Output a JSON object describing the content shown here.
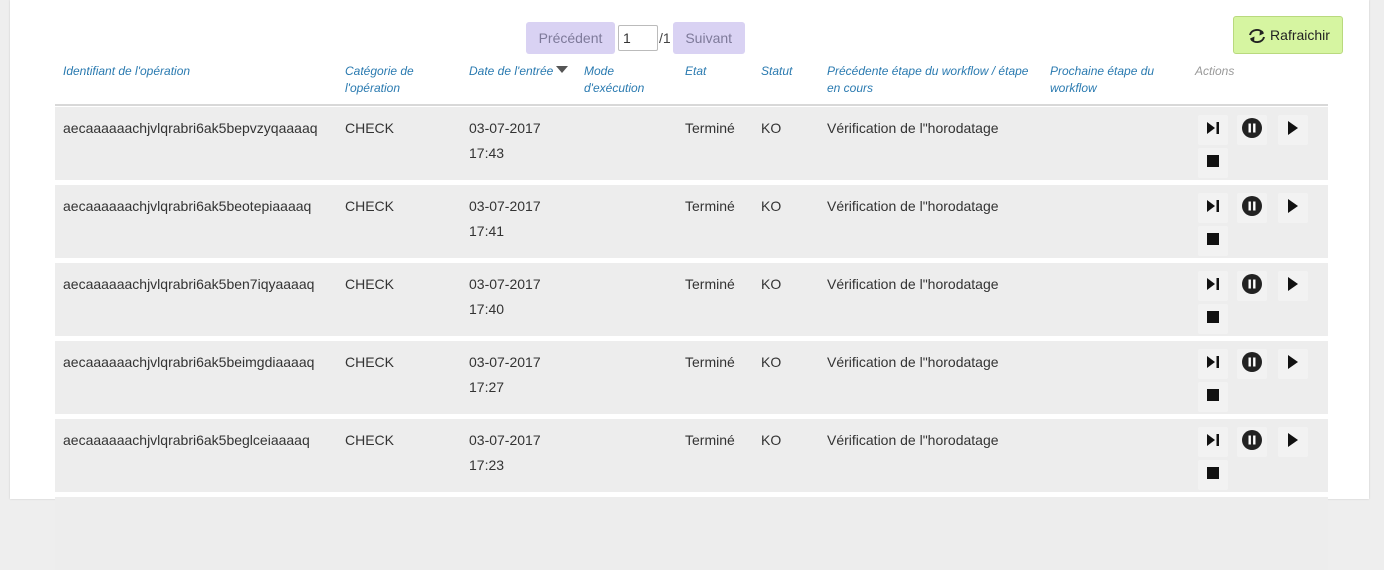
{
  "pagination": {
    "prev_label": "Précédent",
    "page_value": "1",
    "total": "/1",
    "next_label": "Suivant"
  },
  "refresh": {
    "label": "Rafraichir",
    "icon": "refresh-icon",
    "color": "#d6f5a1"
  },
  "columns": {
    "id": "Identifiant de l'opération",
    "category": "Catégorie de l'opération",
    "date": "Date de l'entrée",
    "mode": "Mode d'exécution",
    "state": "Etat",
    "status": "Statut",
    "prev_step": "Précédente étape du workflow / étape en cours",
    "next_step": "Prochaine étape du workflow",
    "actions": "Actions"
  },
  "rows": [
    {
      "id": "aecaaaaaachjvlqrabri6ak5bepvzyqaaaaq",
      "category": "CHECK",
      "date": "03-07-2017",
      "time": "17:43",
      "mode": "",
      "state": "Terminé",
      "status": "KO",
      "prev_step": "Vérification de l\"horodatage",
      "next_step": ""
    },
    {
      "id": "aecaaaaaachjvlqrabri6ak5beotepiaaaaq",
      "category": "CHECK",
      "date": "03-07-2017",
      "time": "17:41",
      "mode": "",
      "state": "Terminé",
      "status": "KO",
      "prev_step": "Vérification de l\"horodatage",
      "next_step": ""
    },
    {
      "id": "aecaaaaaachjvlqrabri6ak5ben7iqyaaaaq",
      "category": "CHECK",
      "date": "03-07-2017",
      "time": "17:40",
      "mode": "",
      "state": "Terminé",
      "status": "KO",
      "prev_step": "Vérification de l\"horodatage",
      "next_step": ""
    },
    {
      "id": "aecaaaaaachjvlqrabri6ak5beimgdiaaaaq",
      "category": "CHECK",
      "date": "03-07-2017",
      "time": "17:27",
      "mode": "",
      "state": "Terminé",
      "status": "KO",
      "prev_step": "Vérification de l\"horodatage",
      "next_step": ""
    },
    {
      "id": "aecaaaaaachjvlqrabri6ak5beglceiaaaaq",
      "category": "CHECK",
      "date": "03-07-2017",
      "time": "17:23",
      "mode": "",
      "state": "Terminé",
      "status": "KO",
      "prev_step": "Vérification de l\"horodatage",
      "next_step": ""
    }
  ],
  "row_actions": [
    "next-step-icon",
    "pause-icon",
    "play-icon",
    "stop-icon"
  ]
}
